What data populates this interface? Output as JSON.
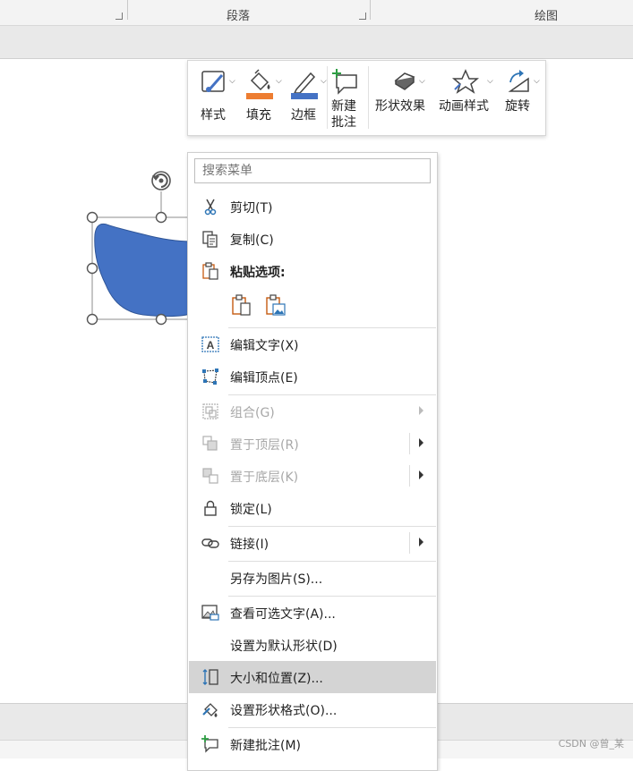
{
  "ribbon": {
    "groups": [
      {
        "label": "段落"
      },
      {
        "label": "绘图"
      }
    ]
  },
  "mini_toolbar": {
    "buttons": [
      {
        "label": "样式"
      },
      {
        "label": "填充"
      },
      {
        "label": "边框"
      },
      {
        "label": "新建\n批注",
        "line1": "新建",
        "line2": "批注"
      },
      {
        "label": "形状效果"
      },
      {
        "label": "动画样式"
      },
      {
        "label": "旋转"
      }
    ],
    "colors": {
      "fill_bar": "#ED7D31",
      "border_bar": "#4472C4"
    }
  },
  "shape": {
    "fill": "#4472C4"
  },
  "context_menu": {
    "search_placeholder": "搜索菜单",
    "items": [
      {
        "label": "剪切(T)",
        "icon": "scissors-icon"
      },
      {
        "label": "复制(C)",
        "icon": "copy-icon"
      },
      {
        "label": "粘贴选项:",
        "icon": "paste-icon"
      },
      {
        "label": "编辑文字(X)",
        "icon": "edit-text-icon"
      },
      {
        "label": "编辑顶点(E)",
        "icon": "edit-points-icon"
      },
      {
        "label": "组合(G)",
        "icon": "group-icon"
      },
      {
        "label": "置于顶层(R)",
        "icon": "bring-to-front-icon"
      },
      {
        "label": "置于底层(K)",
        "icon": "send-to-back-icon"
      },
      {
        "label": "锁定(L)",
        "icon": "lock-icon"
      },
      {
        "label": "链接(I)",
        "icon": "link-icon"
      },
      {
        "label": "另存为图片(S)..."
      },
      {
        "label": "查看可选文字(A)...",
        "icon": "alt-text-icon"
      },
      {
        "label": "设置为默认形状(D)"
      },
      {
        "label": "大小和位置(Z)...",
        "icon": "size-position-icon"
      },
      {
        "label": "设置形状格式(O)...",
        "icon": "format-shape-icon"
      },
      {
        "label": "新建批注(M)",
        "icon": "new-comment-icon"
      }
    ]
  },
  "watermark": "CSDN @曾_某"
}
